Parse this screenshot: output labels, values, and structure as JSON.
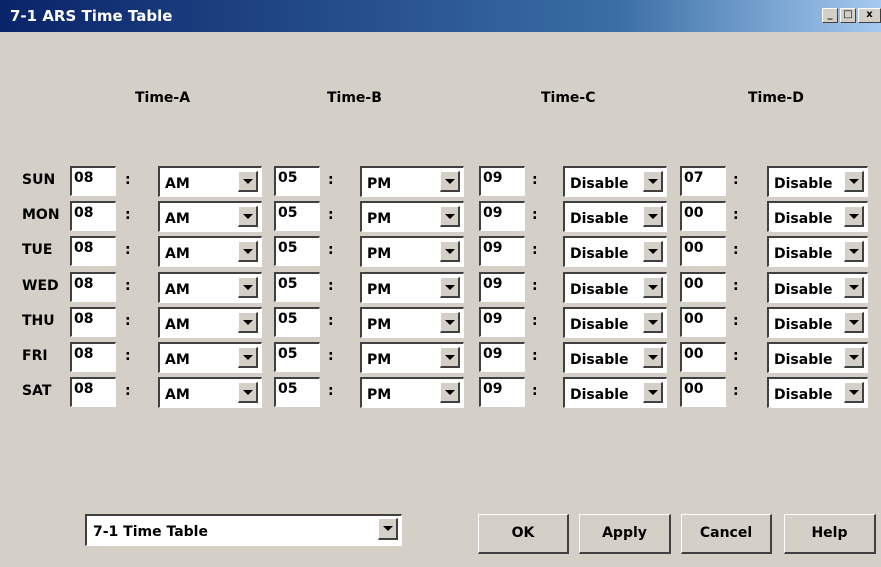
{
  "window": {
    "title": "7-1 ARS Time Table",
    "minimize_glyph": "_",
    "maximize_glyph": "□",
    "close_glyph": "x"
  },
  "columns": [
    "Time-A",
    "Time-B",
    "Time-C",
    "Time-D"
  ],
  "colon": ":",
  "rows": [
    {
      "day": "SUN",
      "a_hour": "08",
      "a_period": "AM",
      "b_hour": "05",
      "b_period": "PM",
      "c_hour": "09",
      "c_period": "Disable",
      "d_hour": "07",
      "d_period": "Disable"
    },
    {
      "day": "MON",
      "a_hour": "08",
      "a_period": "AM",
      "b_hour": "05",
      "b_period": "PM",
      "c_hour": "09",
      "c_period": "Disable",
      "d_hour": "00",
      "d_period": "Disable"
    },
    {
      "day": "TUE",
      "a_hour": "08",
      "a_period": "AM",
      "b_hour": "05",
      "b_period": "PM",
      "c_hour": "09",
      "c_period": "Disable",
      "d_hour": "00",
      "d_period": "Disable"
    },
    {
      "day": "WED",
      "a_hour": "08",
      "a_period": "AM",
      "b_hour": "05",
      "b_period": "PM",
      "c_hour": "09",
      "c_period": "Disable",
      "d_hour": "00",
      "d_period": "Disable"
    },
    {
      "day": "THU",
      "a_hour": "08",
      "a_period": "AM",
      "b_hour": "05",
      "b_period": "PM",
      "c_hour": "09",
      "c_period": "Disable",
      "d_hour": "00",
      "d_period": "Disable"
    },
    {
      "day": "FRI",
      "a_hour": "08",
      "a_period": "AM",
      "b_hour": "05",
      "b_period": "PM",
      "c_hour": "09",
      "c_period": "Disable",
      "d_hour": "00",
      "d_period": "Disable"
    },
    {
      "day": "SAT",
      "a_hour": "08",
      "a_period": "AM",
      "b_hour": "05",
      "b_period": "PM",
      "c_hour": "09",
      "c_period": "Disable",
      "d_hour": "00",
      "d_period": "Disable"
    }
  ],
  "footer": {
    "table_select": "7-1 Time Table",
    "ok_label": "OK",
    "apply_label": "Apply",
    "cancel_label": "Cancel",
    "help_label": "Help"
  }
}
